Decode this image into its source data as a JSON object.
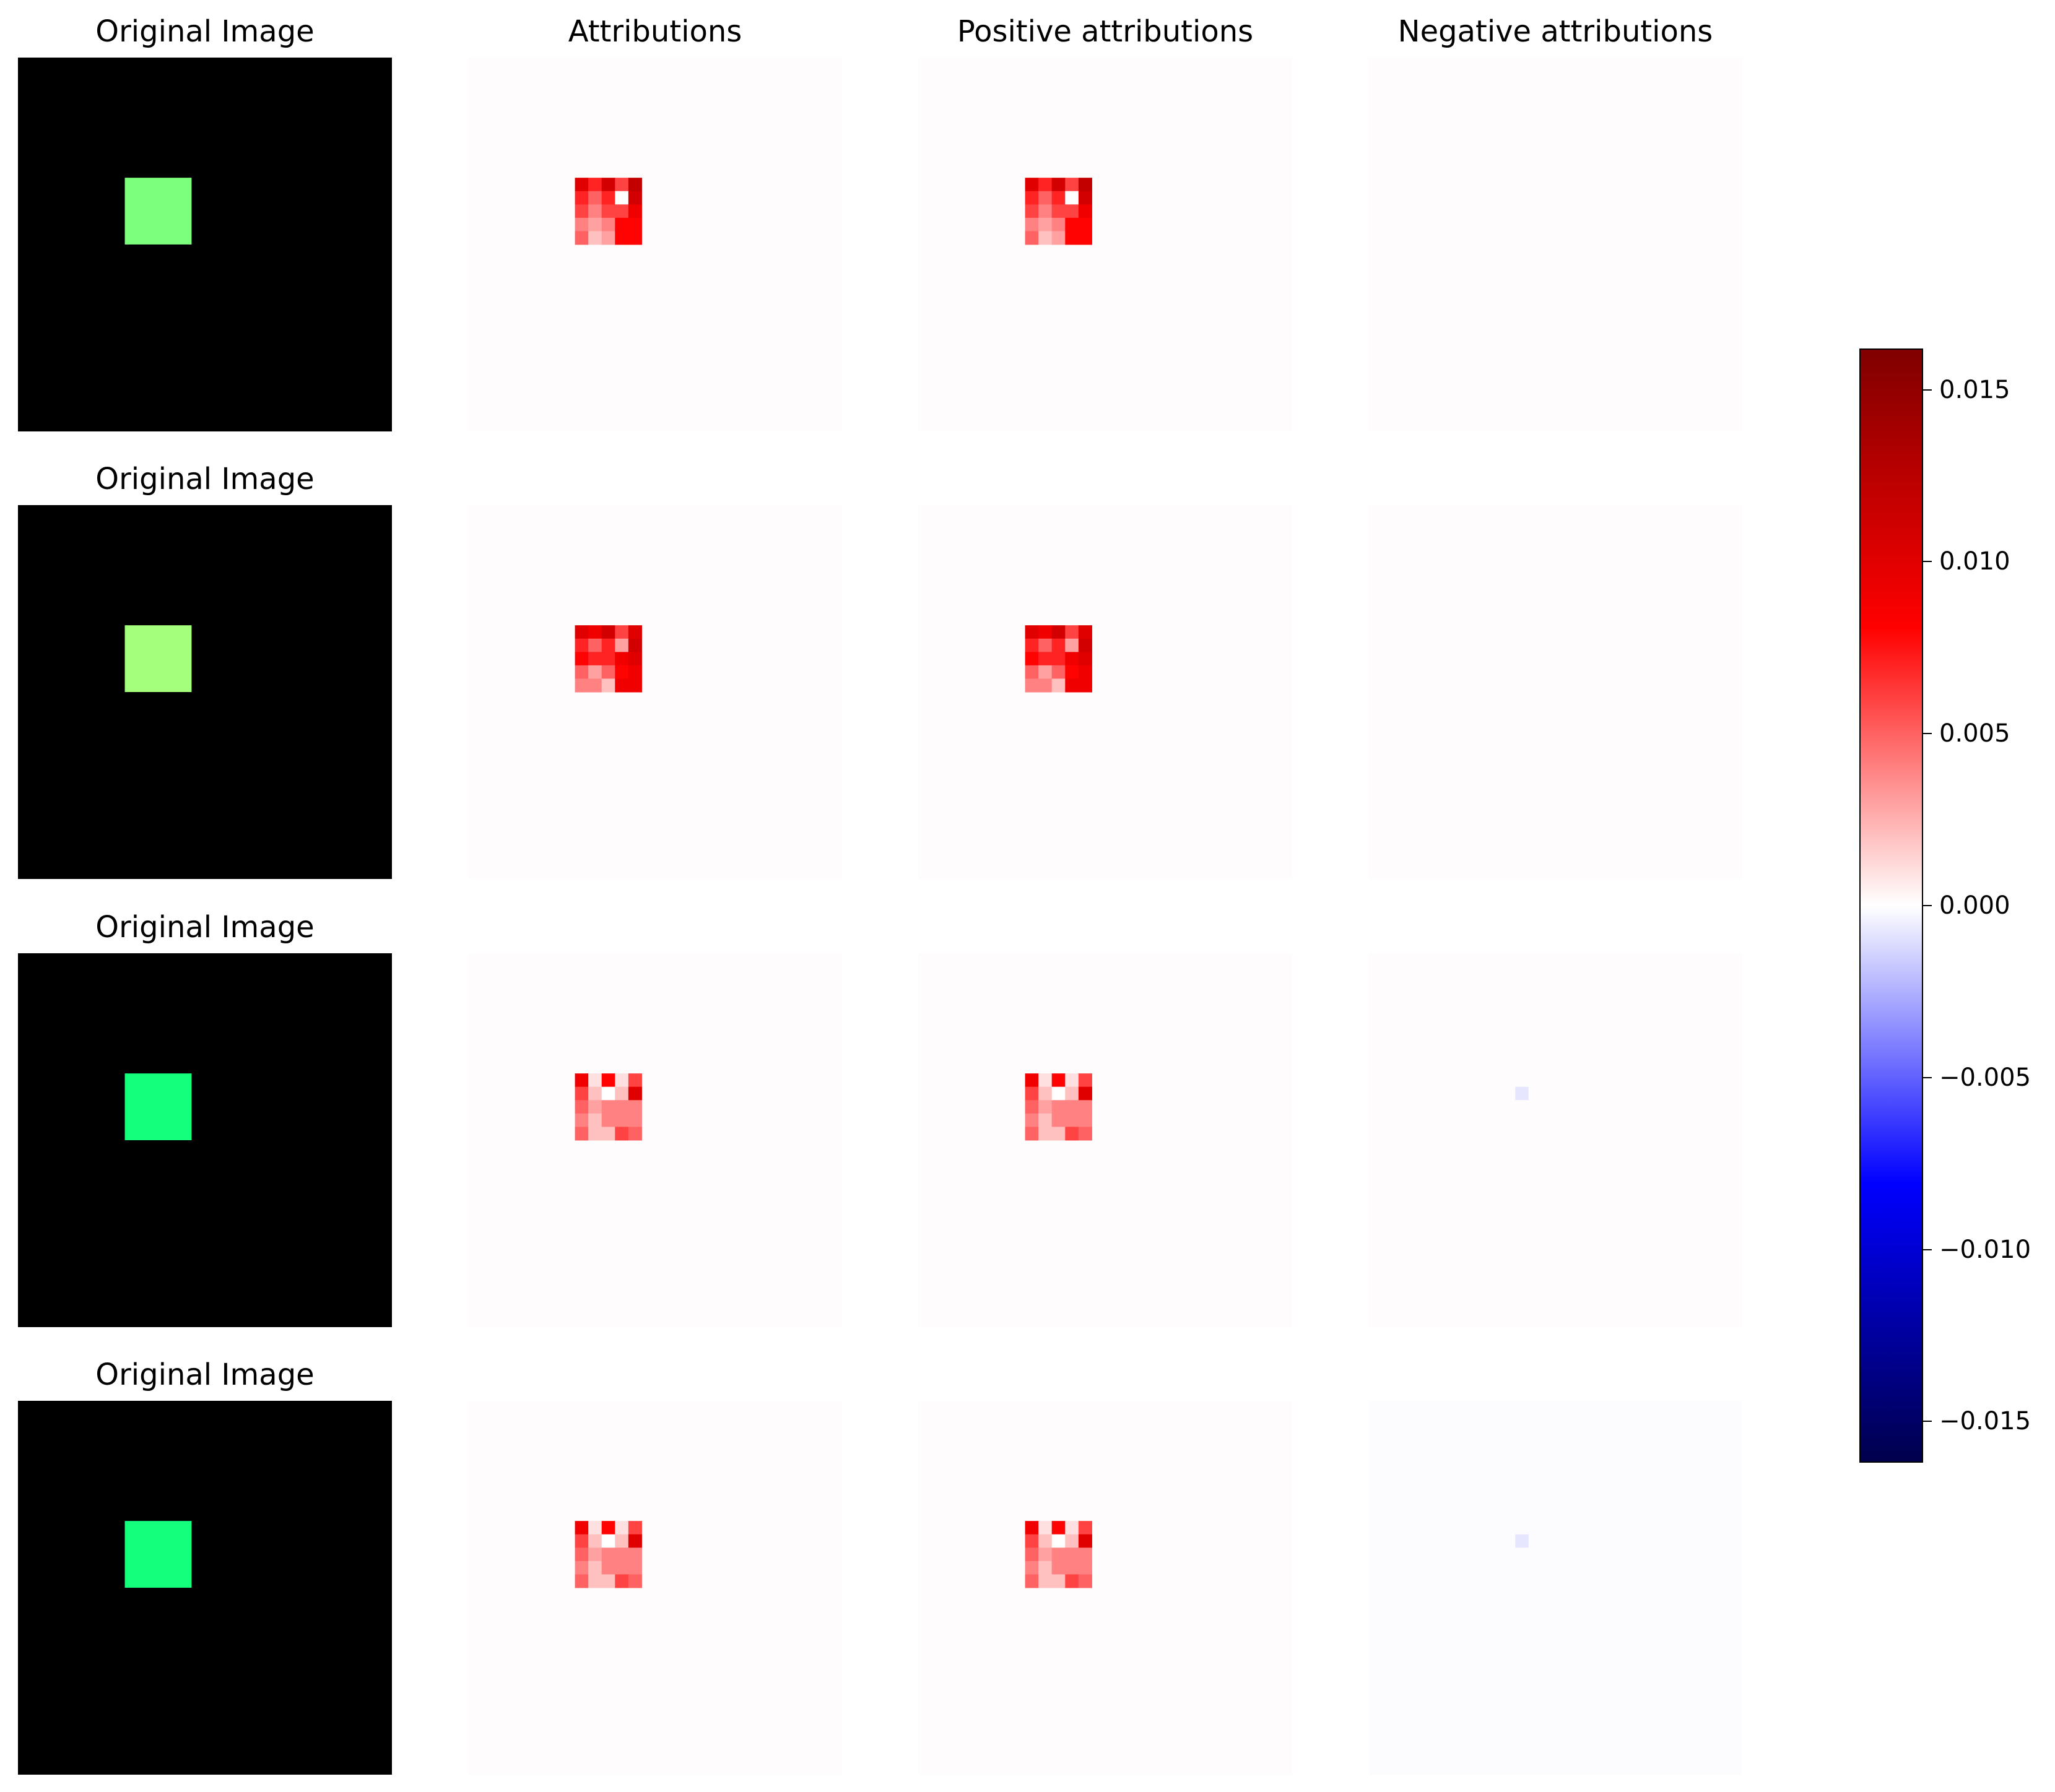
{
  "chart_data": {
    "type": "heatmap",
    "column_titles": [
      "Original Image",
      "Attributions",
      "Positive attributions",
      "Negative attributions"
    ],
    "row_titles": [
      "Original Image",
      "Original Image",
      "Original Image",
      "Original Image"
    ],
    "image_grid_size": 28,
    "patch_grid": {
      "row_start": 9,
      "col_start": 8,
      "rows": 5,
      "cols": 5
    },
    "patch_colors": [
      "#7cff7c",
      "#a4ff7c",
      "#14ff7c",
      "#14ff7c"
    ],
    "attribution_patches": [
      [
        [
          0.01,
          0.007,
          0.011,
          0.006,
          0.012
        ],
        [
          0.007,
          0.005,
          0.007,
          0.0,
          0.011
        ],
        [
          0.006,
          0.004,
          0.006,
          0.006,
          0.009
        ],
        [
          0.004,
          0.003,
          0.004,
          0.008,
          0.008
        ],
        [
          0.005,
          0.002,
          0.003,
          0.008,
          0.008
        ]
      ],
      [
        [
          0.01,
          0.009,
          0.011,
          0.006,
          0.01
        ],
        [
          0.007,
          0.005,
          0.007,
          0.003,
          0.011
        ],
        [
          0.008,
          0.007,
          0.007,
          0.009,
          0.01
        ],
        [
          0.005,
          0.003,
          0.005,
          0.008,
          0.009
        ],
        [
          0.004,
          0.004,
          0.002,
          0.009,
          0.009
        ]
      ],
      [
        [
          0.009,
          0.001,
          0.008,
          0.001,
          0.006
        ],
        [
          0.006,
          0.002,
          0.0,
          0.002,
          0.01
        ],
        [
          0.005,
          0.003,
          0.004,
          0.004,
          0.004
        ],
        [
          0.004,
          0.002,
          0.004,
          0.004,
          0.004
        ],
        [
          0.005,
          0.002,
          0.002,
          0.006,
          0.005
        ]
      ],
      [
        [
          0.009,
          0.001,
          0.008,
          0.001,
          0.006
        ],
        [
          0.006,
          0.002,
          0.0,
          0.002,
          0.01
        ],
        [
          0.005,
          0.003,
          0.004,
          0.004,
          0.004
        ],
        [
          0.004,
          0.002,
          0.004,
          0.004,
          0.004
        ],
        [
          0.005,
          0.002,
          0.002,
          0.006,
          0.005
        ]
      ]
    ],
    "negative_cells": [
      null,
      null,
      {
        "row": 10,
        "col": 11,
        "value": -0.0008
      },
      {
        "row": 10,
        "col": 11,
        "value": -0.0008
      }
    ],
    "colorbar": {
      "colormap": "seismic",
      "vmin": -0.0162,
      "vmax": 0.0162,
      "ticks": [
        0.015,
        0.01,
        0.005,
        0.0,
        -0.005,
        -0.01,
        -0.015
      ],
      "tick_labels": [
        "0.015",
        "0.010",
        "0.005",
        "0.000",
        "−0.005",
        "−0.010",
        "−0.015"
      ]
    },
    "colors": {
      "original_background": "#000000",
      "attribution_background": "#fffcfd"
    }
  }
}
